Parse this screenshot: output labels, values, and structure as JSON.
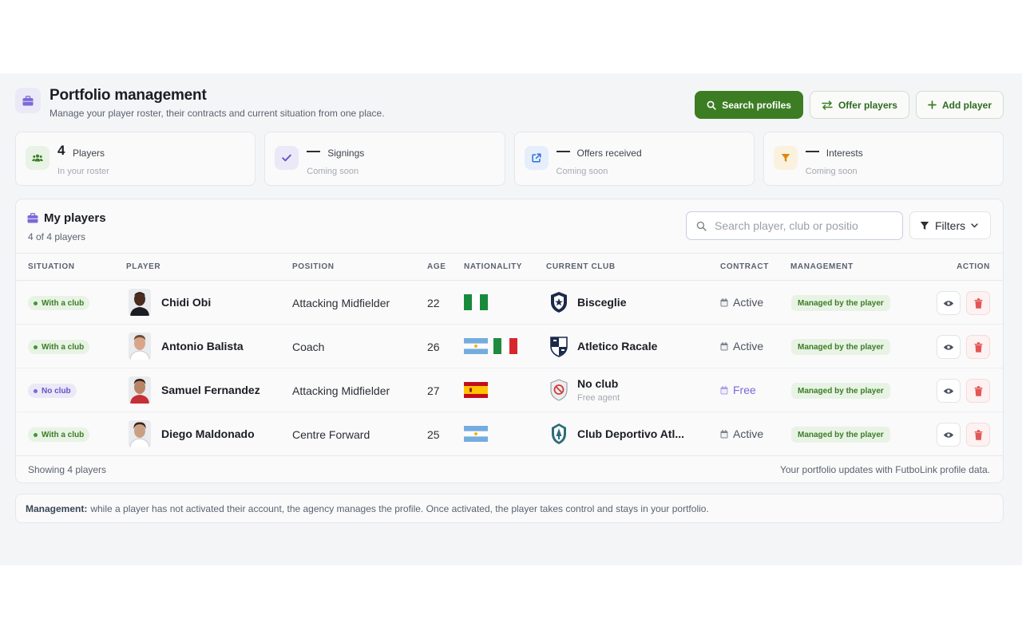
{
  "header": {
    "icon": "briefcase-icon",
    "title": "Portfolio management",
    "subtitle": "Manage your player roster, their contracts and current situation from one place.",
    "buttons": {
      "search_profiles": "Search profiles",
      "offer_players": "Offer players",
      "add_player": "Add player"
    }
  },
  "stats": [
    {
      "icon": "users-icon",
      "value": "4",
      "label": "Players",
      "sub": "In your roster",
      "color": "#3c7d24"
    },
    {
      "icon": "check-icon",
      "value": "",
      "label": "Signings",
      "sub": "Coming soon",
      "color": "#6355c7"
    },
    {
      "icon": "external-link-icon",
      "value": "",
      "label": "Offers received",
      "sub": "Coming soon",
      "color": "#2f6fd6"
    },
    {
      "icon": "funnel-icon",
      "value": "",
      "label": "Interests",
      "sub": "Coming soon",
      "color": "#d98a0c"
    }
  ],
  "panel": {
    "title": "My players",
    "subtitle": "4 of 4 players",
    "search_placeholder": "Search player, club or positio",
    "filters_label": "Filters",
    "columns": {
      "situation": "SITUATION",
      "player": "PLAYER",
      "position": "POSITION",
      "age": "AGE",
      "nationality": "NATIONALITY",
      "club": "CURRENT CLUB",
      "contract": "CONTRACT",
      "management": "MANAGEMENT",
      "action": "ACTION"
    },
    "rows": [
      {
        "situation": "With a club",
        "situation_type": "green",
        "name": "Chidi Obi",
        "position": "Attacking Midfielder",
        "age": "22",
        "nationality": [
          "nigeria-flag"
        ],
        "club": "Bisceglie",
        "club_sub": "",
        "contract": "Active",
        "management": "Managed by the player"
      },
      {
        "situation": "With a club",
        "situation_type": "green",
        "name": "Antonio Balista",
        "position": "Coach",
        "age": "26",
        "nationality": [
          "argentina-flag",
          "italy-flag"
        ],
        "club": "Atletico Racale",
        "club_sub": "",
        "contract": "Active",
        "management": "Managed by the player"
      },
      {
        "situation": "No club",
        "situation_type": "purple",
        "name": "Samuel Fernandez",
        "position": "Attacking Midfielder",
        "age": "27",
        "nationality": [
          "spain-flag"
        ],
        "club": "No club",
        "club_sub": "Free agent",
        "contract": "Free",
        "management": "Managed by the player"
      },
      {
        "situation": "With a club",
        "situation_type": "green",
        "name": "Diego Maldonado",
        "position": "Centre Forward",
        "age": "25",
        "nationality": [
          "argentina-flag"
        ],
        "club": "Club Deportivo Atl...",
        "club_sub": "",
        "contract": "Active",
        "management": "Managed by the player"
      }
    ],
    "footer_left": "Showing 4 players",
    "footer_right": "Your portfolio updates with FutboLink profile data."
  },
  "note": {
    "label": "Management:",
    "text": "while a player has not activated their account, the agency manages the profile. Once activated, the player takes control and stays in your portfolio."
  },
  "colors": {
    "accent": "#3c7d24",
    "purple": "#6355c7",
    "danger": "#e25656"
  }
}
